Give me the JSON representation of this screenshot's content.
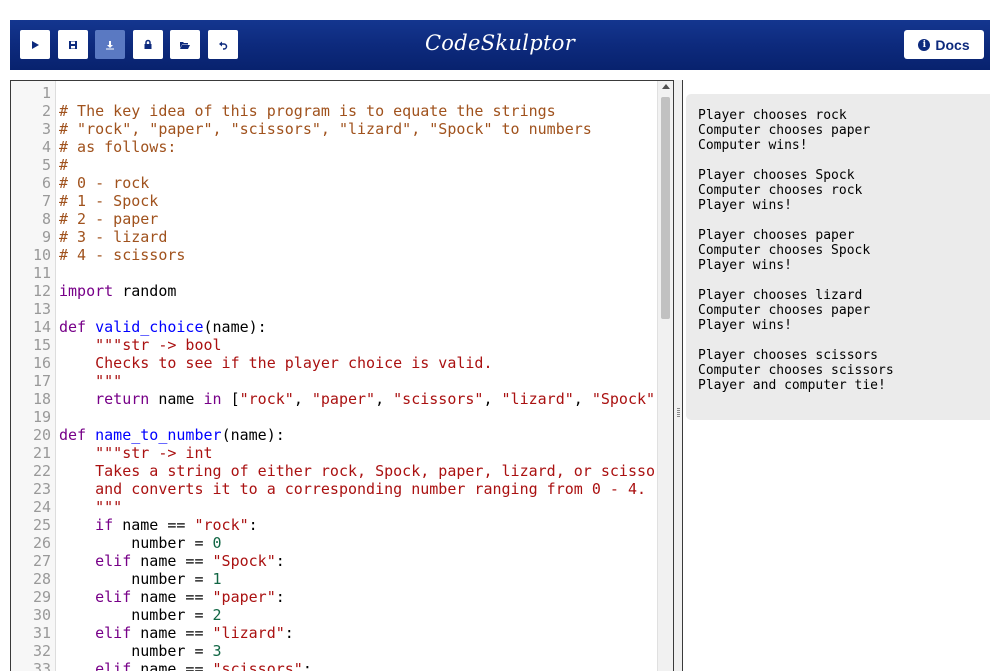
{
  "header": {
    "brand": "CodeSkulptor",
    "docs_label": "Docs",
    "toolbar": [
      {
        "name": "run-button",
        "icon": "play-icon",
        "active": false
      },
      {
        "name": "save-button",
        "icon": "save-icon",
        "active": false
      },
      {
        "name": "download-button",
        "icon": "download-icon",
        "active": true
      },
      {
        "name": "fresh-url-button",
        "icon": "lock-icon",
        "active": false
      },
      {
        "name": "open-local-button",
        "icon": "folder-open-icon",
        "active": false
      },
      {
        "name": "reset-button",
        "icon": "undo-icon",
        "active": false
      }
    ]
  },
  "editor": {
    "lines": [
      {
        "n": "1",
        "t": [
          [
            "",
            ""
          ]
        ]
      },
      {
        "n": "2",
        "t": [
          [
            "c",
            "# The key idea of this program is to equate the strings"
          ]
        ]
      },
      {
        "n": "3",
        "t": [
          [
            "c",
            "# \"rock\", \"paper\", \"scissors\", \"lizard\", \"Spock\" to numbers"
          ]
        ]
      },
      {
        "n": "4",
        "t": [
          [
            "c",
            "# as follows:"
          ]
        ]
      },
      {
        "n": "5",
        "t": [
          [
            "c",
            "#"
          ]
        ]
      },
      {
        "n": "6",
        "t": [
          [
            "c",
            "# 0 - rock"
          ]
        ]
      },
      {
        "n": "7",
        "t": [
          [
            "c",
            "# 1 - Spock"
          ]
        ]
      },
      {
        "n": "8",
        "t": [
          [
            "c",
            "# 2 - paper"
          ]
        ]
      },
      {
        "n": "9",
        "t": [
          [
            "c",
            "# 3 - lizard"
          ]
        ]
      },
      {
        "n": "10",
        "t": [
          [
            "c",
            "# 4 - scissors"
          ]
        ]
      },
      {
        "n": "11",
        "t": [
          [
            "",
            ""
          ]
        ]
      },
      {
        "n": "12",
        "t": [
          [
            "k",
            "import"
          ],
          [
            "",
            " random"
          ]
        ]
      },
      {
        "n": "13",
        "t": [
          [
            "",
            ""
          ]
        ]
      },
      {
        "n": "14",
        "t": [
          [
            "k",
            "def"
          ],
          [
            "",
            " "
          ],
          [
            "d",
            "valid_choice"
          ],
          [
            "",
            "(name):"
          ]
        ]
      },
      {
        "n": "15",
        "t": [
          [
            "",
            "    "
          ],
          [
            "s",
            "\"\"\"str -> bool"
          ]
        ]
      },
      {
        "n": "16",
        "t": [
          [
            "s",
            "    Checks to see if the player choice is valid."
          ]
        ]
      },
      {
        "n": "17",
        "t": [
          [
            "s",
            "    \"\"\""
          ]
        ]
      },
      {
        "n": "18",
        "t": [
          [
            "",
            "    "
          ],
          [
            "k",
            "return"
          ],
          [
            "",
            " name "
          ],
          [
            "k",
            "in"
          ],
          [
            "",
            " ["
          ],
          [
            "s",
            "\"rock\""
          ],
          [
            "",
            ", "
          ],
          [
            "s",
            "\"paper\""
          ],
          [
            "",
            ", "
          ],
          [
            "s",
            "\"scissors\""
          ],
          [
            "",
            ", "
          ],
          [
            "s",
            "\"lizard\""
          ],
          [
            "",
            ", "
          ],
          [
            "s",
            "\"Spock\""
          ],
          [
            "",
            "]"
          ]
        ]
      },
      {
        "n": "19",
        "t": [
          [
            "",
            ""
          ]
        ]
      },
      {
        "n": "20",
        "t": [
          [
            "k",
            "def"
          ],
          [
            "",
            " "
          ],
          [
            "d",
            "name_to_number"
          ],
          [
            "",
            "(name):"
          ]
        ]
      },
      {
        "n": "21",
        "t": [
          [
            "",
            "    "
          ],
          [
            "s",
            "\"\"\"str -> int"
          ]
        ]
      },
      {
        "n": "22",
        "t": [
          [
            "s",
            "    Takes a string of either rock, Spock, paper, lizard, or scissors"
          ]
        ]
      },
      {
        "n": "23",
        "t": [
          [
            "s",
            "    and converts it to a corresponding number ranging from 0 - 4."
          ]
        ]
      },
      {
        "n": "24",
        "t": [
          [
            "s",
            "    \"\"\""
          ]
        ]
      },
      {
        "n": "25",
        "t": [
          [
            "",
            "    "
          ],
          [
            "k",
            "if"
          ],
          [
            "",
            " name == "
          ],
          [
            "s",
            "\"rock\""
          ],
          [
            "",
            ":"
          ]
        ]
      },
      {
        "n": "26",
        "t": [
          [
            "",
            "        number = "
          ],
          [
            "n",
            "0"
          ]
        ]
      },
      {
        "n": "27",
        "t": [
          [
            "",
            "    "
          ],
          [
            "k",
            "elif"
          ],
          [
            "",
            " name == "
          ],
          [
            "s",
            "\"Spock\""
          ],
          [
            "",
            ":"
          ]
        ]
      },
      {
        "n": "28",
        "t": [
          [
            "",
            "        number = "
          ],
          [
            "n",
            "1"
          ]
        ]
      },
      {
        "n": "29",
        "t": [
          [
            "",
            "    "
          ],
          [
            "k",
            "elif"
          ],
          [
            "",
            " name == "
          ],
          [
            "s",
            "\"paper\""
          ],
          [
            "",
            ":"
          ]
        ]
      },
      {
        "n": "30",
        "t": [
          [
            "",
            "        number = "
          ],
          [
            "n",
            "2"
          ]
        ]
      },
      {
        "n": "31",
        "t": [
          [
            "",
            "    "
          ],
          [
            "k",
            "elif"
          ],
          [
            "",
            " name == "
          ],
          [
            "s",
            "\"lizard\""
          ],
          [
            "",
            ":"
          ]
        ]
      },
      {
        "n": "32",
        "t": [
          [
            "",
            "        number = "
          ],
          [
            "n",
            "3"
          ]
        ]
      },
      {
        "n": "33",
        "t": [
          [
            "",
            "    "
          ],
          [
            "k",
            "elif"
          ],
          [
            "",
            " name == "
          ],
          [
            "s",
            "\"scissors\""
          ],
          [
            "",
            ":"
          ]
        ]
      }
    ]
  },
  "output": {
    "lines": [
      "Player chooses rock",
      "Computer chooses paper",
      "Computer wins!",
      "",
      "Player chooses Spock",
      "Computer chooses rock",
      "Player wins!",
      "",
      "Player chooses paper",
      "Computer chooses Spock",
      "Player wins!",
      "",
      "Player chooses lizard",
      "Computer chooses paper",
      "Player wins!",
      "",
      "Player chooses scissors",
      "Computer chooses scissors",
      "Player and computer tie!"
    ]
  },
  "colors": {
    "header_bg": "#0d2a7d",
    "active_button": "#5a79c2",
    "comment": "#a0521d",
    "keyword": "#770088",
    "def_name": "#0000ff",
    "string": "#aa1111",
    "number": "#116644",
    "output_bg": "#ebebeb"
  }
}
